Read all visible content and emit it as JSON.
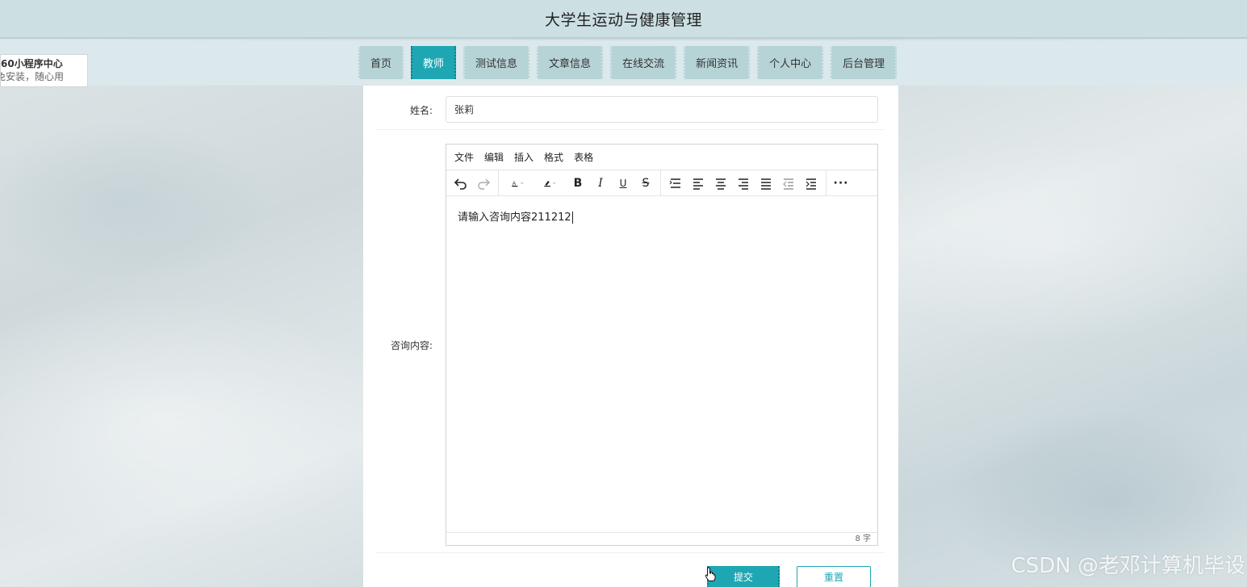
{
  "site": {
    "title": "大学生运动与健康管理"
  },
  "promo": {
    "title": "60小程序中心",
    "subtitle": "免安装，随心用"
  },
  "nav": {
    "items": [
      {
        "label": "首页",
        "active": false
      },
      {
        "label": "教师",
        "active": true
      },
      {
        "label": "测试信息",
        "active": false
      },
      {
        "label": "文章信息",
        "active": false
      },
      {
        "label": "在线交流",
        "active": false
      },
      {
        "label": "新闻资讯",
        "active": false
      },
      {
        "label": "个人中心",
        "active": false
      },
      {
        "label": "后台管理",
        "active": false
      }
    ]
  },
  "form": {
    "name_label": "姓名:",
    "name_value": "张莉",
    "content_label": "咨询内容:",
    "editor": {
      "menu": [
        "文件",
        "编辑",
        "插入",
        "格式",
        "表格"
      ],
      "content": "请输入咨询内容211212",
      "word_count": "8 字"
    },
    "submit_label": "提交",
    "reset_label": "重置"
  },
  "watermark": "CSDN @老邓计算机毕设",
  "colors": {
    "accent": "#1fa6b3",
    "nav_bg": "#b6d3d6",
    "topbar": "#cce0e3"
  }
}
